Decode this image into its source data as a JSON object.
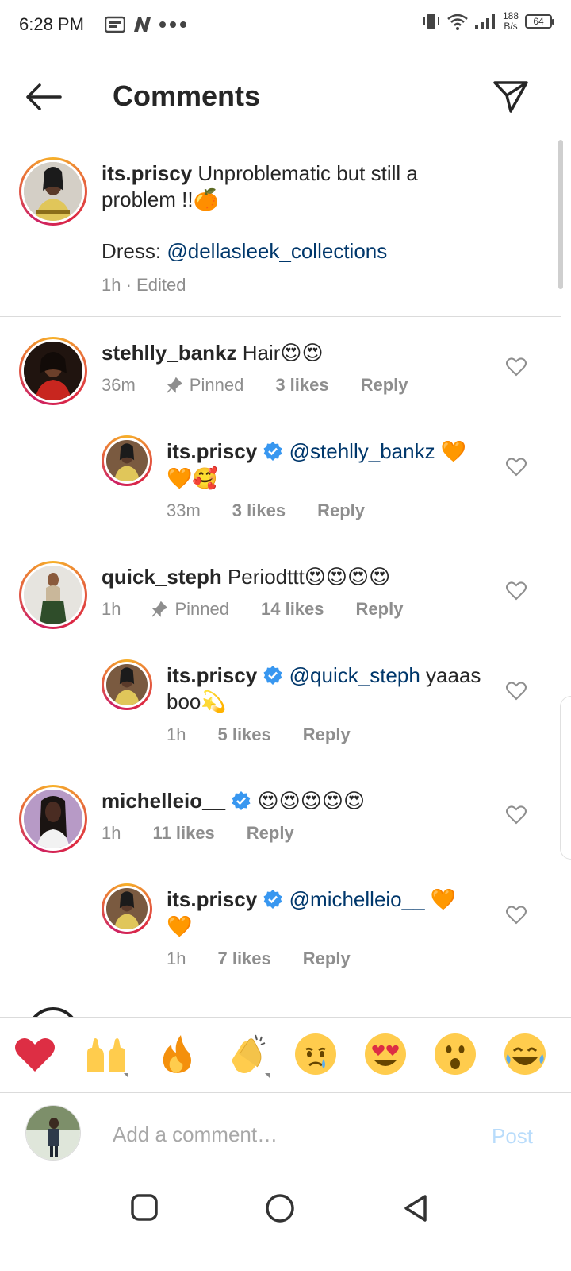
{
  "status_bar": {
    "time": "6:28 PM",
    "net_speed_value": "188",
    "net_speed_unit": "B/s",
    "battery": "64"
  },
  "header": {
    "title": "Comments"
  },
  "caption": {
    "username": "its.priscy",
    "text_line1": "Unproblematic but still a",
    "text_line2": "problem !!",
    "dress_label": "Dress:",
    "dress_mention": "@dellasleek_collections",
    "time": "1h",
    "edited": "Edited"
  },
  "comments": [
    {
      "username": "stehlly_bankz",
      "text": "Hair",
      "emojis": "😍😍",
      "time": "36m",
      "pinned": "Pinned",
      "likes": "3 likes",
      "reply": "Reply",
      "avatar_color": "#2a1a14",
      "reply_item": {
        "username": "its.priscy",
        "mention": "@stehlly_bankz",
        "emojis_inline": "🧡",
        "emojis_line2": "🧡🥰",
        "time": "33m",
        "likes": "3 likes",
        "reply": "Reply"
      }
    },
    {
      "username": "quick_steph",
      "text": "Periodttt",
      "emojis": "😍😍😍😍",
      "time": "1h",
      "pinned": "Pinned",
      "likes": "14 likes",
      "reply": "Reply",
      "avatar_color": "#d8d8d6",
      "reply_item": {
        "username": "its.priscy",
        "mention": "@quick_steph",
        "text_inline": "yaaas",
        "text_line2": "boo",
        "emojis_line2": "💫",
        "time": "1h",
        "likes": "5 likes",
        "reply": "Reply"
      }
    },
    {
      "username": "michelleio__",
      "emojis": "😍😍😍😍😍",
      "time": "1h",
      "likes": "11 likes",
      "reply": "Reply",
      "avatar_color": "#b79ac6",
      "reply_item": {
        "username": "its.priscy",
        "mention": "@michelleio__",
        "emojis_inline": "🧡",
        "emojis_line2": "🧡",
        "time": "1h",
        "likes": "7 likes",
        "reply": "Reply"
      }
    }
  ],
  "emoji_bar": [
    "❤️",
    "🙌",
    "🔥",
    "👏",
    "😢",
    "😍",
    "😮",
    "😂"
  ],
  "add_comment": {
    "placeholder": "Add a comment…",
    "post_label": "Post"
  },
  "colors": {
    "verified": "#3897f0",
    "mention": "#00376b",
    "meta_text": "#8e8e8e",
    "post_disabled": "#b9dcfb"
  }
}
